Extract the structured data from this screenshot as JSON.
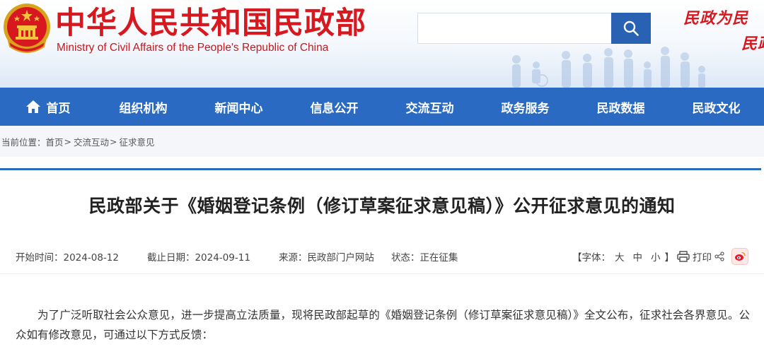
{
  "header": {
    "title_cn": "中华人民共和国民政部",
    "title_en": "Ministry of Civil Affairs of the People's Republic of China",
    "slogan_line1": "民政为民",
    "slogan_line2": "民政",
    "search": {
      "placeholder": "",
      "value": ""
    }
  },
  "nav": {
    "items": [
      {
        "label": "首页",
        "icon": "home-icon"
      },
      {
        "label": "组织机构"
      },
      {
        "label": "新闻中心"
      },
      {
        "label": "信息公开"
      },
      {
        "label": "交流互动"
      },
      {
        "label": "政务服务"
      },
      {
        "label": "民政数据"
      },
      {
        "label": "民政文化"
      }
    ]
  },
  "breadcrumb": {
    "prefix": "当前位置：",
    "items": [
      "首页",
      "交流互动",
      "征求意见"
    ],
    "separator": ">"
  },
  "article": {
    "title": "民政部关于《婚姻登记条例（修订草案征求意见稿）》公开征求意见的通知",
    "meta": {
      "start_label": "开始时间：",
      "start_value": "2024-08-12",
      "end_label": "截止日期：",
      "end_value": "2024-09-11",
      "source_label": "来源：",
      "source_value": "民政部门户网站",
      "status_label": "状态：",
      "status_value": "正在征集"
    },
    "tools": {
      "font_label_open": "【字体：",
      "font_large": "大",
      "font_medium": "中",
      "font_small": "小",
      "font_label_close": "】",
      "print_label": "打印"
    },
    "paragraph": "为了广泛听取社会公众意见，进一步提高立法质量，现将民政部起草的《婚姻登记条例（修订草案征求意见稿）》全文公布，征求社会各界意见。公众如有修改意见，可通过以下方式反馈："
  },
  "colors": {
    "brand_red": "#d7191f",
    "nav_blue": "#2a6ac2",
    "search_blue": "#2a62b3"
  }
}
